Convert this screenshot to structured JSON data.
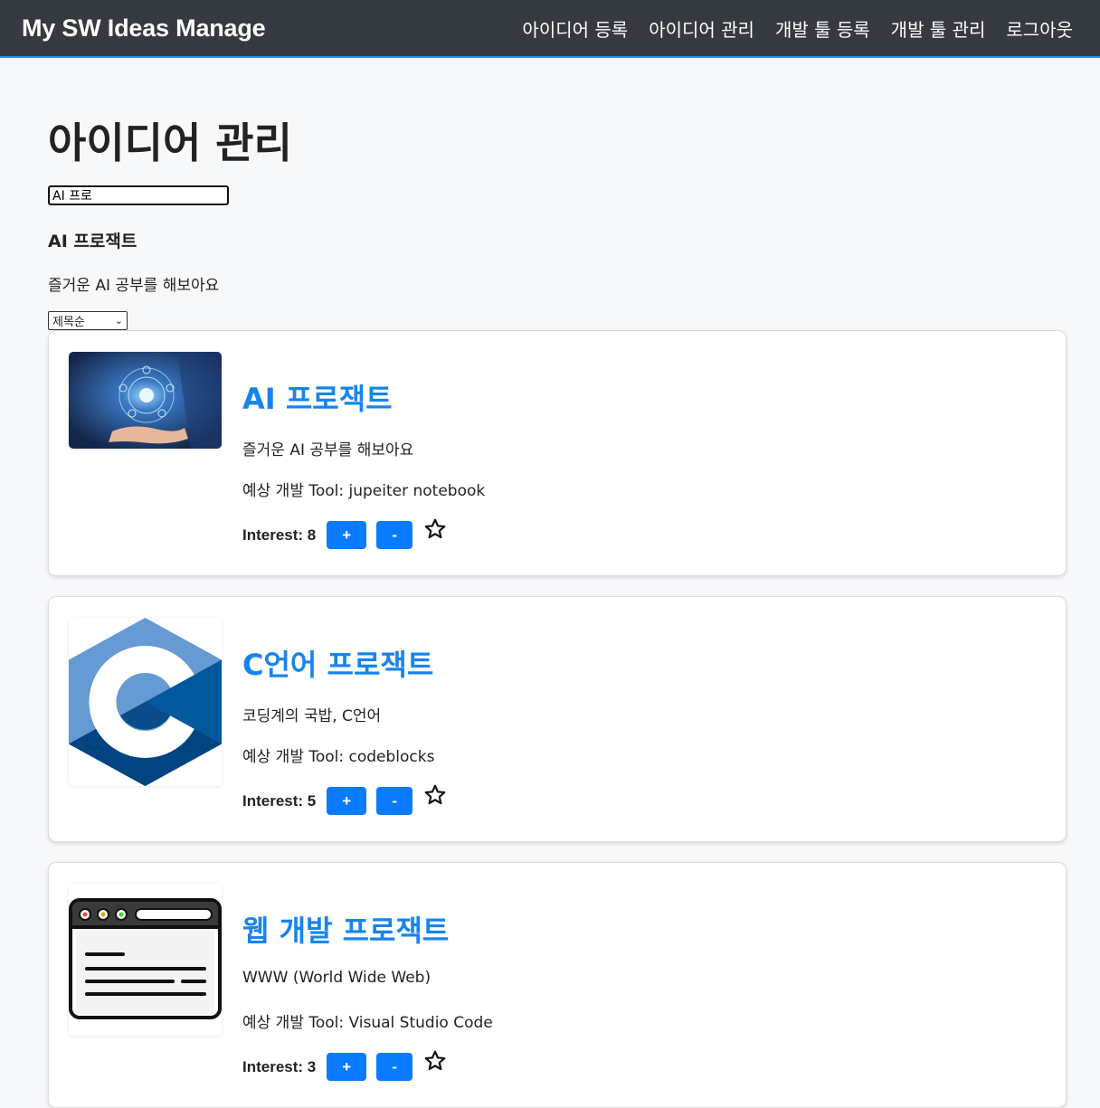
{
  "nav": {
    "brand": "My SW Ideas Manage",
    "links": [
      "아이디어 등록",
      "아이디어 관리",
      "개발 툴 등록",
      "개발 툴 관리",
      "로그아웃"
    ]
  },
  "page": {
    "title": "아이디어 관리",
    "search_value": "AI 프로",
    "result_title": "AI 프로잭트",
    "result_desc": "즐거운 AI 공부를 해보아요",
    "sort_selected": "제목순"
  },
  "cards": [
    {
      "image": "ai-hand-image",
      "title": "AI 프로잭트",
      "desc": "즐거운 AI 공부를 해보아요",
      "tool": "예상 개발 Tool: jupeiter notebook",
      "interest": "Interest: 8",
      "plus": "+",
      "minus": "-"
    },
    {
      "image": "c-language-logo",
      "title": "C언어 프로잭트",
      "desc": "코딩계의 국밥, C언어",
      "tool": "예상 개발 Tool: codeblocks",
      "interest": "Interest: 5",
      "plus": "+",
      "minus": "-"
    },
    {
      "image": "browser-window-icon",
      "title": "웹 개발 프로잭트",
      "desc": "WWW (World Wide Web)",
      "tool": "예상 개발 Tool: Visual Studio Code",
      "interest": "Interest: 3",
      "plus": "+",
      "minus": "-"
    }
  ],
  "colors": {
    "navbar": "#343a40",
    "accent": "#0a7bff",
    "title_link": "#1784ee"
  }
}
